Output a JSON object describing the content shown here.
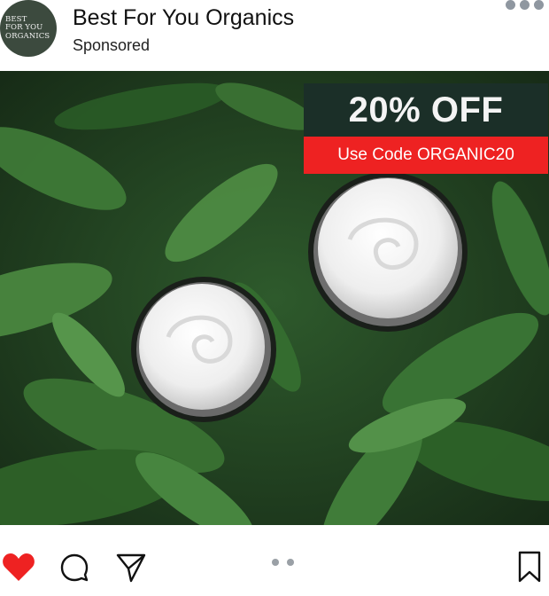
{
  "post": {
    "avatar_lines": [
      "BEST",
      "FOR YOU",
      "ORGANICS"
    ],
    "account_name": "Best For You Organics",
    "sponsored_label": "Sponsored"
  },
  "promo": {
    "headline": "20% OFF",
    "code_text": "Use Code ORGANIC20"
  },
  "icons": {
    "more": "more-options-icon",
    "like": "heart-icon",
    "comment": "comment-icon",
    "share": "send-icon",
    "save": "bookmark-icon"
  },
  "carousel": {
    "count": 2,
    "active": 1
  },
  "colors": {
    "promo_dark": "#1b2f28",
    "promo_red": "#ee2222",
    "like_red": "#ee2222",
    "avatar_green": "#3c4a3e"
  }
}
